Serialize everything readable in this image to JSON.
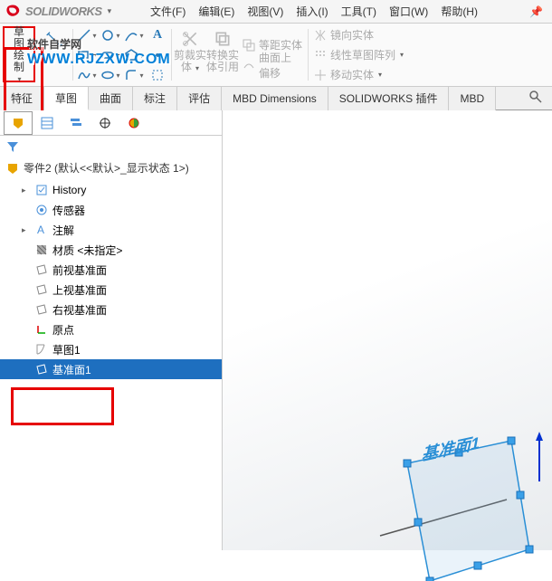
{
  "app": {
    "name": "SOLIDWORKS"
  },
  "menu": {
    "file": "文件(F)",
    "edit": "编辑(E)",
    "view": "视图(V)",
    "insert": "插入(I)",
    "tools": "工具(T)",
    "window": "窗口(W)",
    "help": "帮助(H)"
  },
  "ribbon": {
    "sketch": {
      "label1": "草图绘",
      "label2": "制"
    },
    "trim": {
      "label1": "剪裁实",
      "label2": "体"
    },
    "convert": {
      "label1": "转换实",
      "label2": "体引用"
    },
    "offset": {
      "label1": "曲面上",
      "label2": "偏移"
    },
    "equidist": "等距实体",
    "mirror": "镜向实体",
    "linear": "线性草图阵列",
    "move": "移动实体"
  },
  "tabs": {
    "feature": "特征",
    "sketch": "草图",
    "surface": "曲面",
    "annotate": "标注",
    "evaluate": "评估",
    "mbd": "MBD Dimensions",
    "addin": "SOLIDWORKS 插件",
    "mbd2": "MBD"
  },
  "tree": {
    "part": "零件2 (默认<<默认>_显示状态 1>)",
    "history": "History",
    "sensor": "传感器",
    "annotation": "注解",
    "material": "材质 <未指定>",
    "front": "前视基准面",
    "top": "上视基准面",
    "right": "右视基准面",
    "origin": "原点",
    "sketch1": "草图1",
    "plane1": "基准面1"
  },
  "viewport": {
    "plane_label": "基准面1"
  },
  "watermark": {
    "title": "软件自学网",
    "url": "WWW.RJZXW.COM"
  }
}
